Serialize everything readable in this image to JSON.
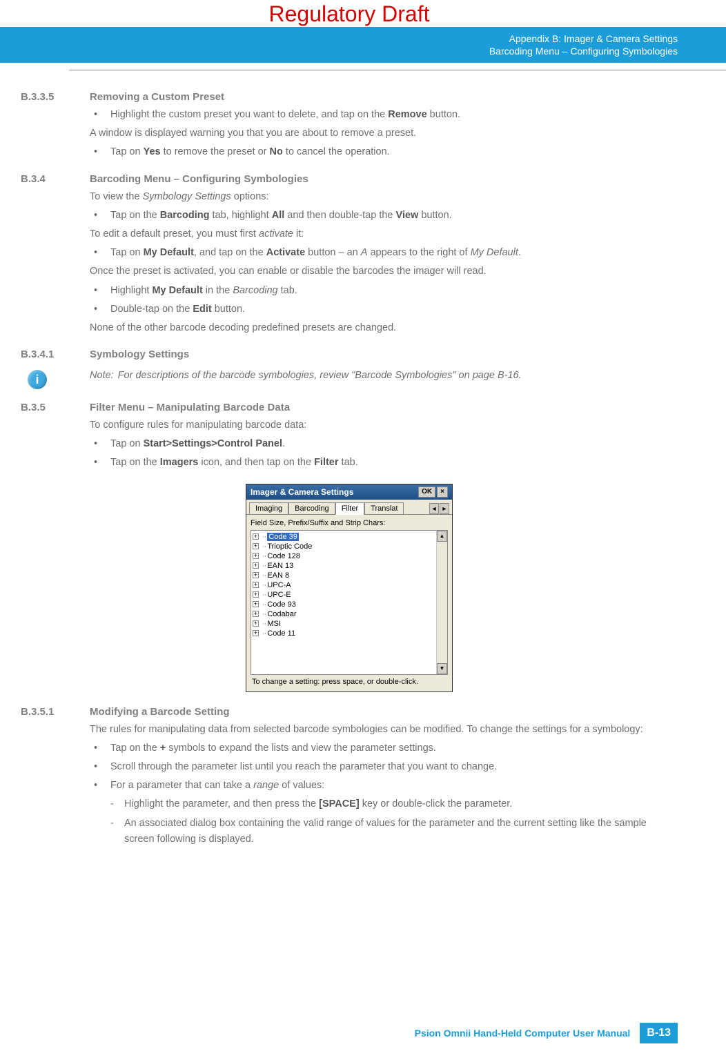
{
  "watermark": "Regulatory Draft",
  "header": {
    "line1": "Appendix B: Imager & Camera Settings",
    "line2": "Barcoding Menu – Configuring Symbologies"
  },
  "s1": {
    "num": "B.3.3.5",
    "title": "Removing a Custom Preset",
    "b1a": "Highlight the custom preset you want to delete, and tap on the ",
    "b1b": "Remove",
    "b1c": " button.",
    "p1": "A window is displayed warning you that you are about to remove a preset.",
    "b2a": "Tap on ",
    "b2b": "Yes",
    "b2c": " to remove the preset or ",
    "b2d": "No",
    "b2e": " to cancel the operation."
  },
  "s2": {
    "num": "B.3.4",
    "title": "Barcoding Menu – Configuring Symbologies",
    "p1a": "To view the ",
    "p1b": "Symbology Settings",
    "p1c": " options:",
    "b1a": "Tap on the ",
    "b1b": "Barcoding",
    "b1c": " tab, highlight ",
    "b1d": "All",
    "b1e": " and then double-tap the ",
    "b1f": "View",
    "b1g": " button.",
    "p2a": "To edit a default preset, you must first ",
    "p2b": "activate",
    "p2c": " it:",
    "b2a": "Tap on ",
    "b2b": "My Default",
    "b2c": ", and tap on the ",
    "b2d": "Activate",
    "b2e": " button – an ",
    "b2f": "A",
    "b2g": " appears to the right of ",
    "b2h": "My Default",
    "b2i": ".",
    "p3": "Once the preset is activated, you can enable or disable the barcodes the imager will read.",
    "b3a": "Highlight ",
    "b3b": "My Default",
    "b3c": " in the ",
    "b3d": "Barcoding",
    "b3e": " tab.",
    "b4a": "Double-tap on the ",
    "b4b": "Edit",
    "b4c": " button.",
    "p4": "None of the other barcode decoding predefined presets are changed."
  },
  "s3": {
    "num": "B.3.4.1",
    "title": "Symbology Settings",
    "noteLabel": "Note:",
    "note": "For descriptions of the barcode symbologies, review \"Barcode Symbologies\" on page B-16."
  },
  "s4": {
    "num": "B.3.5",
    "title": "Filter Menu – Manipulating Barcode Data",
    "p1": "To configure rules for manipulating barcode data:",
    "b1a": "Tap on ",
    "b1b": "Start>Settings>Control Panel",
    "b1c": ".",
    "b2a": "Tap on the ",
    "b2b": "Imagers",
    "b2c": " icon, and then tap on the ",
    "b2d": "Filter",
    "b2e": " tab."
  },
  "shot": {
    "title": "Imager & Camera Settings",
    "ok": "OK",
    "close": "×",
    "tabs": {
      "t1": "Imaging",
      "t2": "Barcoding",
      "t3": "Filter",
      "t4": "Translat"
    },
    "label": "Field Size, Prefix/Suffix and Strip Chars:",
    "items": [
      "Code 39",
      "Trioptic Code",
      "Code 128",
      "EAN 13",
      "EAN 8",
      "UPC-A",
      "UPC-E",
      "Code 93",
      "Codabar",
      "MSI",
      "Code 11"
    ],
    "hint": "To change a setting: press space, or double-click."
  },
  "s5": {
    "num": "B.3.5.1",
    "title": "Modifying a Barcode Setting",
    "p1": "The rules for manipulating data from selected barcode symbologies can be modified. To change the settings for a symbology:",
    "b1a": "Tap on the ",
    "b1b": "+",
    "b1c": " symbols to expand the lists and view the parameter settings.",
    "b2": "Scroll through the parameter list until you reach the parameter that you want to change.",
    "b3a": "For a parameter that can take a ",
    "b3b": "range",
    "b3c": " of values:",
    "sb1a": "Highlight the parameter, and then press the ",
    "sb1b": "[SPACE]",
    "sb1c": " key or double-click the parameter.",
    "sb2": "An associated dialog box containing the valid range of values for the parameter and the current setting like the sample screen following is displayed."
  },
  "footer": {
    "text": "Psion Omnii Hand-Held Computer User Manual",
    "page": "B-13"
  }
}
